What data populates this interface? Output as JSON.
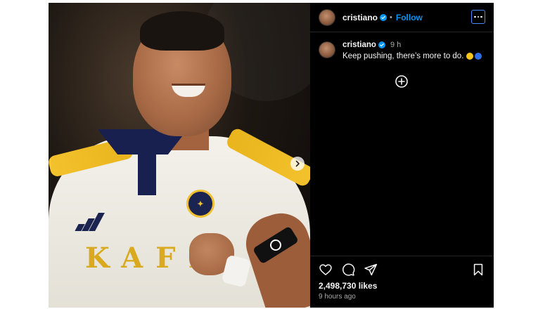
{
  "header": {
    "username": "cristiano",
    "separator": "•",
    "follow_label": "Follow"
  },
  "caption": {
    "username": "cristiano",
    "time": "9 h",
    "text": "Keep pushing, there’s more to do.",
    "emoji": [
      "yellow-circle",
      "blue-circle"
    ]
  },
  "photo": {
    "sponsor_text": "KAFD"
  },
  "stats": {
    "likes": "2,498,730 likes",
    "posted_ago": "9 hours ago"
  },
  "colors": {
    "background": "#000000",
    "follow": "#0095f6",
    "verified": "#0095f6",
    "jersey_gold": "#f0c030",
    "jersey_navy": "#17204e"
  }
}
